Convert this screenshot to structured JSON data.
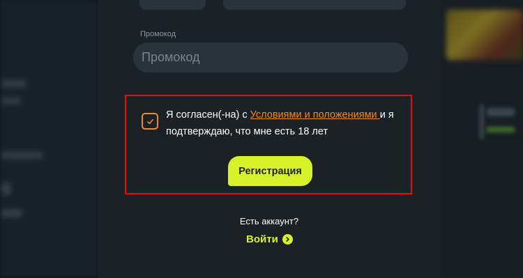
{
  "form": {
    "promo_label": "Промокод",
    "promo_placeholder": "Промокод",
    "promo_value": ""
  },
  "consent": {
    "checked": true,
    "text_before": "Я согласен(-на) с ",
    "link_text": "Условиями и положениями ",
    "text_after": "и я подтверждаю, что мне есть 18 лет"
  },
  "actions": {
    "register_label": "Регистрация",
    "have_account_text": "Есть аккаунт?",
    "login_label": "Войти"
  },
  "icons": {
    "checkbox": "check-icon",
    "login": "chevron-right-circle-icon"
  },
  "colors": {
    "accent_orange": "#f08a24",
    "accent_lime": "#d8f22a",
    "highlight_red": "#e01010",
    "modal_bg": "#1b2227",
    "input_bg": "#28333a"
  }
}
